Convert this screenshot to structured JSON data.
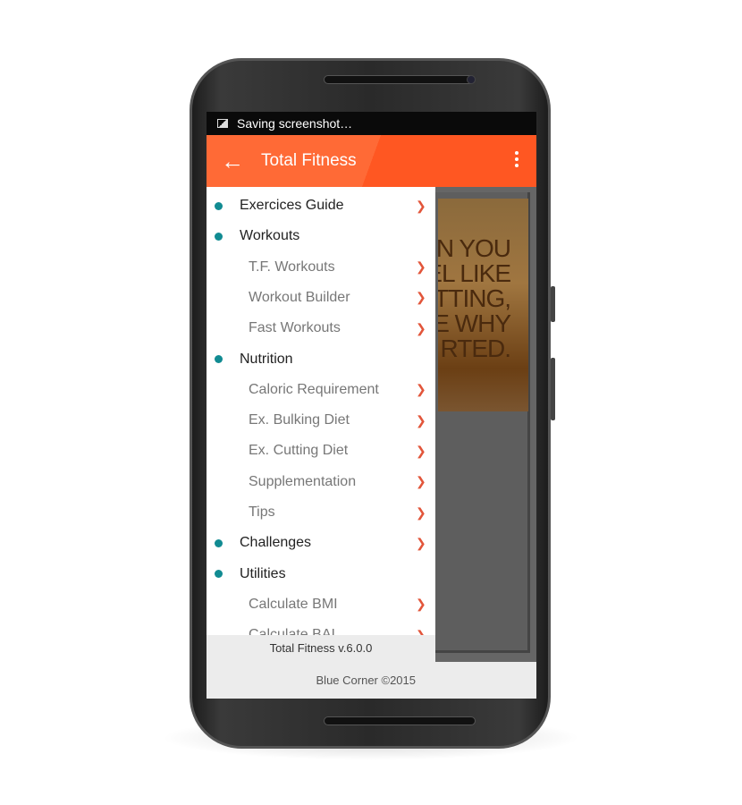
{
  "status": {
    "text": "Saving screenshot…"
  },
  "appbar": {
    "title": "Total Fitness"
  },
  "menu": [
    {
      "label": "Exercices Guide",
      "level": "main",
      "chevron": true
    },
    {
      "label": "Workouts",
      "level": "main",
      "chevron": false
    },
    {
      "label": "T.F. Workouts",
      "level": "sub",
      "chevron": true
    },
    {
      "label": "Workout Builder",
      "level": "sub",
      "chevron": true
    },
    {
      "label": "Fast Workouts",
      "level": "sub",
      "chevron": true
    },
    {
      "label": "Nutrition",
      "level": "main",
      "chevron": false
    },
    {
      "label": "Caloric Requirement",
      "level": "sub",
      "chevron": true
    },
    {
      "label": "Ex. Bulking Diet",
      "level": "sub",
      "chevron": true
    },
    {
      "label": "Ex. Cutting Diet",
      "level": "sub",
      "chevron": true
    },
    {
      "label": "Supplementation",
      "level": "sub",
      "chevron": true
    },
    {
      "label": "Tips",
      "level": "sub",
      "chevron": true
    },
    {
      "label": "Challenges",
      "level": "main",
      "chevron": true
    },
    {
      "label": "Utilities",
      "level": "main",
      "chevron": false
    },
    {
      "label": "Calculate BMI",
      "level": "sub",
      "chevron": true
    },
    {
      "label": "Calculate BAI",
      "level": "sub",
      "chevron": true
    }
  ],
  "footer": {
    "version": "Total Fitness v.6.0.0",
    "copyright": "Blue Corner ©2015"
  },
  "poster": {
    "lines": [
      "N YOU",
      "EL LIKE",
      "ITTING,",
      "E WHY",
      "RTED."
    ]
  },
  "colors": {
    "accent": "#ff5722",
    "bullet": "#118b92",
    "chevron": "#e2553a"
  }
}
